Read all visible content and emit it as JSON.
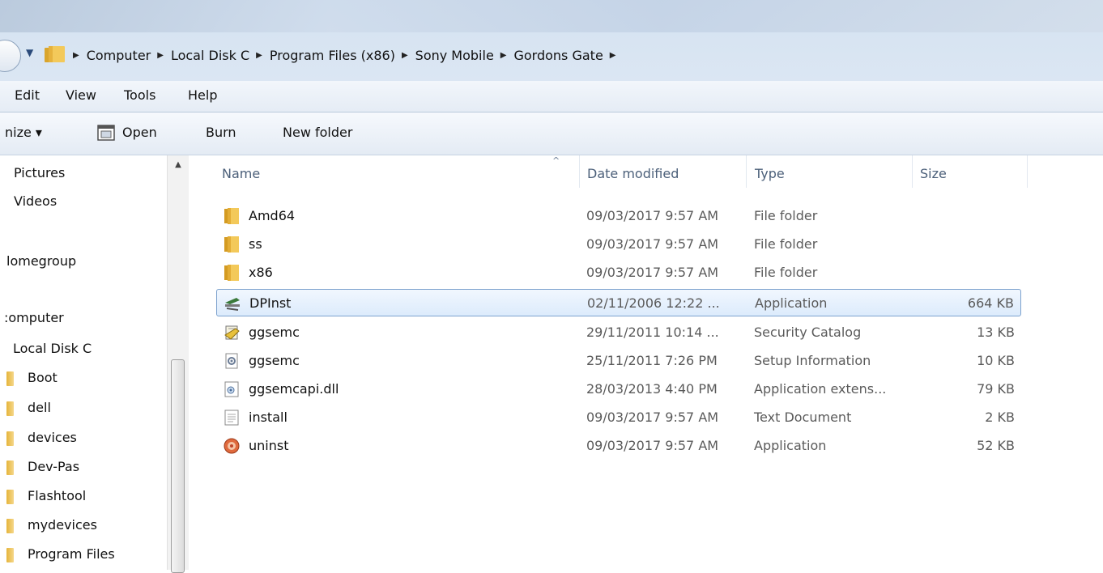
{
  "breadcrumb": [
    "Computer",
    "Local Disk C",
    "Program Files (x86)",
    "Sony Mobile",
    "Gordons Gate"
  ],
  "menu": [
    "Edit",
    "View",
    "Tools",
    "Help"
  ],
  "toolbar": {
    "organize": "nize ▾",
    "open": "Open",
    "burn": "Burn",
    "new_folder": "New folder"
  },
  "nav": {
    "pictures": "Pictures",
    "videos": "Videos",
    "homegroup": "lomegroup",
    "computer": ":omputer",
    "local_disk": "Local Disk C",
    "folders": [
      "Boot",
      "dell",
      "devices",
      "Dev-Pas",
      "Flashtool",
      "mydevices",
      "Program Files"
    ]
  },
  "columns": {
    "name": "Name",
    "date": "Date modified",
    "type": "Type",
    "size": "Size"
  },
  "files": [
    {
      "name": "Amd64",
      "date": "09/03/2017 9:57 AM",
      "type": "File folder",
      "size": "",
      "icon": "folder-icon"
    },
    {
      "name": "ss",
      "date": "09/03/2017 9:57 AM",
      "type": "File folder",
      "size": "",
      "icon": "folder-icon"
    },
    {
      "name": "x86",
      "date": "09/03/2017 9:57 AM",
      "type": "File folder",
      "size": "",
      "icon": "folder-icon"
    },
    {
      "name": "DPInst",
      "date": "02/11/2006 12:22 ...",
      "type": "Application",
      "size": "664 KB",
      "icon": "dpinst-app-icon",
      "selected": true
    },
    {
      "name": "ggsemc",
      "date": "29/11/2011 10:14 ...",
      "type": "Security Catalog",
      "size": "13 KB",
      "icon": "security-catalog-icon"
    },
    {
      "name": "ggsemc",
      "date": "25/11/2011 7:26 PM",
      "type": "Setup Information",
      "size": "10 KB",
      "icon": "setup-info-icon"
    },
    {
      "name": "ggsemcapi.dll",
      "date": "28/03/2013 4:40 PM",
      "type": "Application extens...",
      "size": "79 KB",
      "icon": "dll-icon"
    },
    {
      "name": "install",
      "date": "09/03/2017 9:57 AM",
      "type": "Text Document",
      "size": "2 KB",
      "icon": "text-document-icon"
    },
    {
      "name": "uninst",
      "date": "09/03/2017 9:57 AM",
      "type": "Application",
      "size": "52 KB",
      "icon": "uninstaller-icon"
    }
  ]
}
